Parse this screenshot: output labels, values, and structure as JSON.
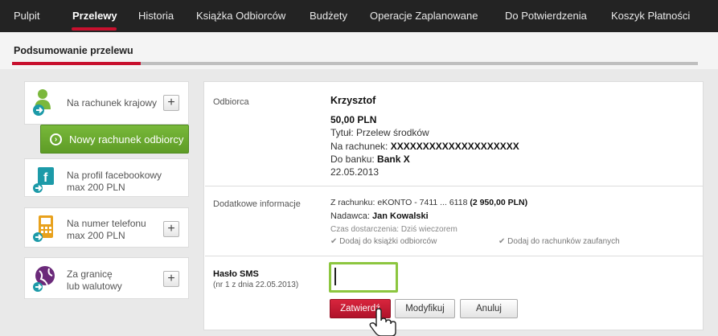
{
  "nav": {
    "items": [
      "Pulpit",
      "Przelewy",
      "Historia",
      "Książka Odbiorców",
      "Budżety",
      "Operacje Zaplanowane",
      "Do Potwierdzenia",
      "Koszyk Płatności"
    ],
    "active_index": 1
  },
  "summary": {
    "title": "Podsumowanie przelewu"
  },
  "sidebar": {
    "domestic": {
      "label": "Na rachunek krajowy",
      "plus": "+"
    },
    "new_recipient": {
      "label": "Nowy rachunek odbiorcy"
    },
    "facebook": {
      "line1": "Na profil facebookowy",
      "line2": "max 200 PLN"
    },
    "phone": {
      "line1": "Na numer telefonu",
      "line2": "max 200 PLN",
      "plus": "+"
    },
    "foreign": {
      "line1": "Za granicę",
      "line2": "lub walutowy",
      "plus": "+"
    }
  },
  "recipient": {
    "label": "Odbiorca",
    "name": "Krzysztof",
    "amount": "50,00 PLN",
    "title": "Tytuł: Przelew środków",
    "account_label": "Na rachunek:",
    "account_value": "XXXXXXXXXXXXXXXXXXXX",
    "bank_label": "Do banku:",
    "bank_value": "Bank X",
    "date": "22.05.2013"
  },
  "additional": {
    "label": "Dodatkowe informacje",
    "from_account": "Z rachunku: eKONTO - 7411 ... 6118",
    "balance": "(2 950,00 PLN)",
    "sender_label": "Nadawca:",
    "sender_value": "Jan Kowalski",
    "delivery": "Czas dostarczenia: Dziś wieczorem",
    "add_book": "Dodaj do książki odbiorców",
    "add_trusted": "Dodaj do rachunków zaufanych"
  },
  "sms": {
    "label": "Hasło SMS",
    "sub": "(nr 1 z dnia 22.05.2013)",
    "value": ""
  },
  "buttons": {
    "confirm": "Zatwierdź",
    "modify": "Modyfikuj",
    "cancel": "Anuluj"
  },
  "colors": {
    "accent_red": "#c8102e",
    "green": "#6aaa2e",
    "nav_bg": "#232323",
    "icon_teal": "#1c9aa8",
    "icon_green": "#7bb83c"
  }
}
